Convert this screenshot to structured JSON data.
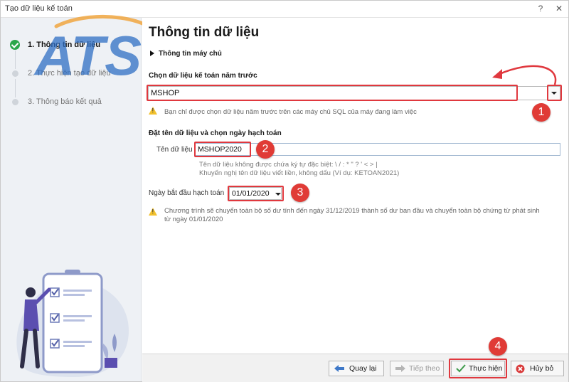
{
  "window": {
    "title": "Tạo dữ liệu kế toán",
    "help_label": "?",
    "close_label": "✕"
  },
  "steps": [
    {
      "label": "1. Thông tin dữ liệu",
      "status": "done"
    },
    {
      "label": "2. Thực hiện tạo dữ liệu",
      "status": "pending"
    },
    {
      "label": "3. Thông báo kết quả",
      "status": "pending"
    }
  ],
  "logo_text": "ATS",
  "main": {
    "title": "Thông tin dữ liệu",
    "server_info_label": "Thông tin máy chủ",
    "prev_data_label": "Chọn dữ liệu kế toán năm trước",
    "prev_data_value": "MSHOP",
    "prev_data_warning": "Bạn chỉ được chọn dữ liệu năm trước trên các máy chủ SQL của máy đang làm việc",
    "name_section_label": "Đặt tên dữ liệu và chọn ngày hạch toán",
    "data_name_label": "Tên dữ liệu *",
    "data_name_value": "MSHOP2020",
    "hint_line1": "Tên dữ liệu không được chứa ký tự đặc biệt: \\ / : * \" ? ' < > |",
    "hint_line2": "Khuyến nghị tên dữ liệu viết liền, không dấu (Ví dụ: KETOAN2021)",
    "start_date_label": "Ngày bắt đầu hạch toán",
    "start_date_value": "01/01/2020",
    "transfer_warning_line1": "Chương trình sẽ chuyển toàn bộ số dư tính đến ngày 31/12/2019 thành số dư ban đầu và chuyển toàn bộ chứng từ phát sinh",
    "transfer_warning_line2": "từ ngày 01/01/2020"
  },
  "annotations": [
    "1",
    "2",
    "3",
    "4"
  ],
  "footer": {
    "back_label": "Quay lại",
    "next_label": "Tiếp theo",
    "execute_label": "Thực hiện",
    "cancel_label": "Hủy bỏ"
  },
  "colors": {
    "highlight": "#e0383e",
    "step_done": "#2aa64a",
    "logo_blue": "#2f6fc4",
    "logo_orange": "#f0a640"
  }
}
